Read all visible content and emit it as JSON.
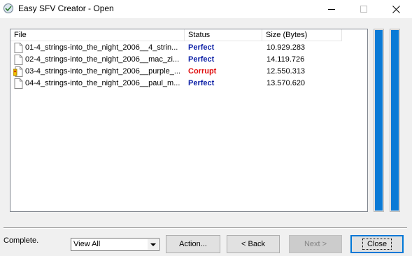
{
  "window": {
    "title": "Easy SFV Creator - Open"
  },
  "list": {
    "columns": [
      "File",
      "Status",
      "Size (Bytes)"
    ],
    "rows": [
      {
        "file": "01-4_strings-into_the_night_2006__4_strin...",
        "status": "Perfect",
        "size": "10.929.283",
        "icon": "file-icon",
        "status_kind": "ok"
      },
      {
        "file": "02-4_strings-into_the_night_2006__mac_zi...",
        "status": "Perfect",
        "size": "14.119.726",
        "icon": "file-icon",
        "status_kind": "ok"
      },
      {
        "file": "03-4_strings-into_the_night_2006__purple_...",
        "status": "Corrupt",
        "size": "12.550.313",
        "icon": "corrupt-file-icon",
        "status_kind": "bad"
      },
      {
        "file": "04-4_strings-into_the_night_2006__paul_m...",
        "status": "Perfect",
        "size": "13.570.620",
        "icon": "file-icon",
        "status_kind": "ok"
      }
    ]
  },
  "progress": {
    "file_progress": 1.0,
    "total_progress": 1.0,
    "color": "#0a7ad6"
  },
  "footer": {
    "status": "Complete.",
    "view_select": "View All",
    "action_label": "Action...",
    "back_label": "< Back",
    "next_label": "Next >",
    "close_label": "Close"
  },
  "colors": {
    "perfect": "#0b1fa6",
    "corrupt": "#e01010"
  }
}
